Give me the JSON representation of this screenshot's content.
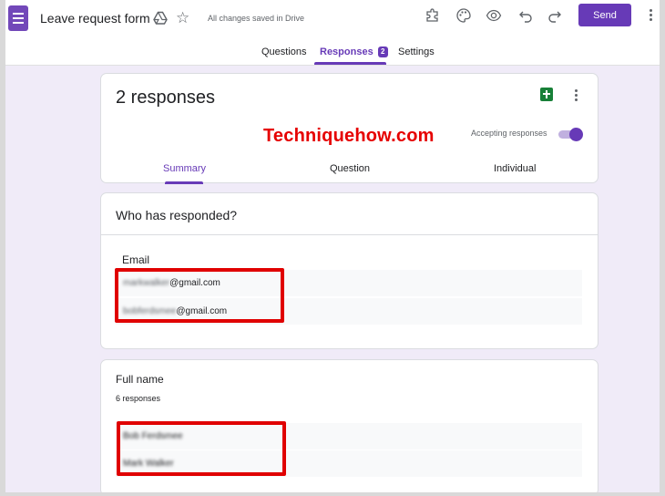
{
  "header": {
    "title": "Leave request form",
    "save_status": "All changes saved in Drive",
    "send_label": "Send",
    "icons": [
      "forms-icon",
      "drive-icon",
      "star-icon",
      "addon-icon",
      "palette-icon",
      "preview-icon",
      "undo-icon",
      "redo-icon",
      "more-vert-icon"
    ]
  },
  "nav": {
    "tabs": [
      {
        "label": "Questions"
      },
      {
        "label": "Responses",
        "badge": "2",
        "active": true
      },
      {
        "label": "Settings"
      }
    ]
  },
  "summary": {
    "title": "2 responses",
    "watermark": "Techniquehow.com",
    "accepting_label": "Accepting responses",
    "accepting": true,
    "subtabs": [
      {
        "label": "Summary",
        "active": true
      },
      {
        "label": "Question"
      },
      {
        "label": "Individual"
      }
    ]
  },
  "responded": {
    "title": "Who has responded?",
    "column_header": "Email",
    "emails": [
      {
        "hidden": "markwalker",
        "domain": "@gmail.com"
      },
      {
        "hidden": "bobferdsmee",
        "domain": "@gmail.com"
      }
    ]
  },
  "full_name": {
    "title": "Full name",
    "count": "6 responses",
    "names": [
      "Bob Ferdsmee",
      "Mark Walker"
    ]
  },
  "colors": {
    "accent": "#673ab7",
    "background": "#f0ebf8",
    "highlight_box": "#e00000"
  }
}
